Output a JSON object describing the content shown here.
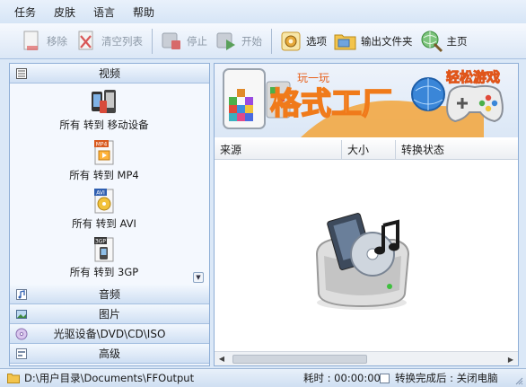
{
  "menu": [
    "任务",
    "皮肤",
    "语言",
    "帮助"
  ],
  "toolbar": {
    "remove": "移除",
    "clear_list": "清空列表",
    "stop": "停止",
    "start": "开始",
    "options": "选项",
    "output_folder": "输出文件夹",
    "home": "主页"
  },
  "left_panel": {
    "video_header": "视频",
    "video_items": [
      {
        "label": "所有 转到 移动设备",
        "icon": "mobile-device-icon"
      },
      {
        "label": "所有 转到 MP4",
        "icon": "mp4-file-icon",
        "badge": "MP4"
      },
      {
        "label": "所有 转到 AVI",
        "icon": "avi-file-icon",
        "badge": "AVI"
      },
      {
        "label": "所有 转到 3GP",
        "icon": "3gp-file-icon",
        "badge": "3GP"
      }
    ],
    "categories": [
      {
        "label": "音频",
        "icon": "audio-icon"
      },
      {
        "label": "图片",
        "icon": "picture-icon"
      },
      {
        "label": "光驱设备\\DVD\\CD\\ISO",
        "icon": "disc-icon"
      },
      {
        "label": "高级",
        "icon": "advanced-icon"
      }
    ]
  },
  "banner": {
    "title": "格式工厂",
    "small_text": "玩一玩",
    "tagline": "轻松游戏"
  },
  "table": {
    "columns": [
      "来源",
      "大小",
      "转换状态"
    ]
  },
  "status": {
    "output_path": "D:\\用户目录\\Documents\\FFOutput",
    "time_label": "耗时 : 00:00:00",
    "after_convert": "转换完成后 : 关闭电脑"
  },
  "colors": {
    "accent": "#4a86c8",
    "banner_title": "#ffffff",
    "banner_title_stroke": "#f07a1a",
    "tagline": "#ffffff",
    "tagline_stroke": "#e0551a"
  }
}
